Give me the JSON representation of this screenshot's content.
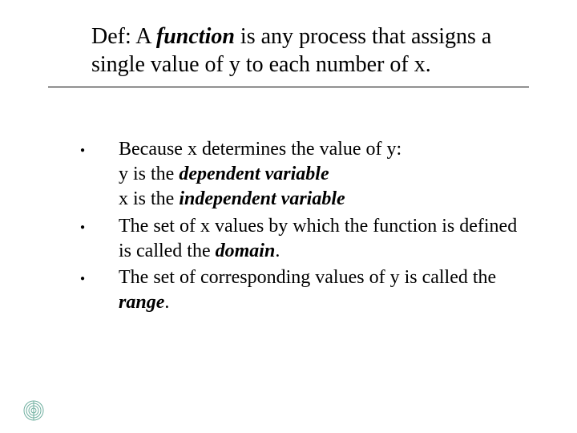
{
  "title": {
    "pre": "Def: A ",
    "em": "function",
    "post": " is any process that assigns a single value of y to each number of x."
  },
  "bullets": [
    {
      "line1_pre": "Because x determines the value of y:",
      "line2_pre": "y is the ",
      "line2_em": "dependent variable",
      "line3_pre": "x is the ",
      "line3_em": "independent variable"
    },
    {
      "line1_pre": "The set of x values by which the function is defined is called the ",
      "line1_em": "domain",
      "line1_post": "."
    },
    {
      "line1_pre": "The set of corresponding values of y is called the ",
      "line1_em": "range",
      "line1_post": "."
    }
  ]
}
